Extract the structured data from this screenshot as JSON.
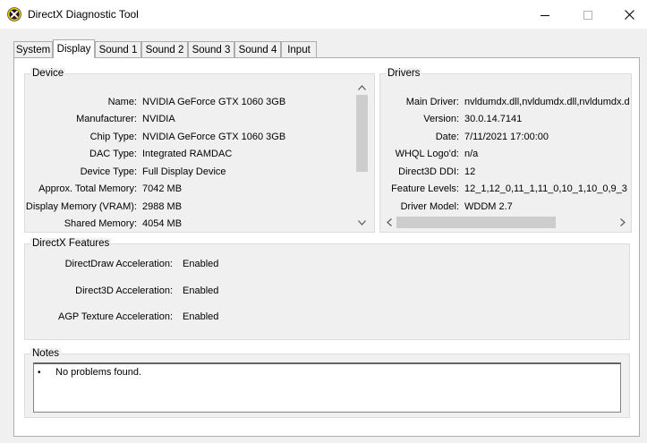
{
  "window": {
    "title": "DirectX Diagnostic Tool",
    "icon": "directx-x-icon"
  },
  "tabs": [
    {
      "label": "System",
      "active": false
    },
    {
      "label": "Display",
      "active": true
    },
    {
      "label": "Sound 1",
      "active": false
    },
    {
      "label": "Sound 2",
      "active": false
    },
    {
      "label": "Sound 3",
      "active": false
    },
    {
      "label": "Sound 4",
      "active": false
    },
    {
      "label": "Input",
      "active": false
    }
  ],
  "device": {
    "title": "Device",
    "rows": [
      {
        "label": "Name:",
        "value": "NVIDIA GeForce GTX 1060 3GB"
      },
      {
        "label": "Manufacturer:",
        "value": "NVIDIA"
      },
      {
        "label": "Chip Type:",
        "value": "NVIDIA GeForce GTX 1060 3GB"
      },
      {
        "label": "DAC Type:",
        "value": "Integrated RAMDAC"
      },
      {
        "label": "Device Type:",
        "value": "Full Display Device"
      },
      {
        "label": "Approx. Total Memory:",
        "value": "7042 MB"
      },
      {
        "label": "Display Memory (VRAM):",
        "value": "2988 MB"
      },
      {
        "label": "Shared Memory:",
        "value": "4054 MB"
      }
    ]
  },
  "drivers": {
    "title": "Drivers",
    "rows": [
      {
        "label": "Main Driver:",
        "value": "nvldumdx.dll,nvldumdx.dll,nvldumdx.d"
      },
      {
        "label": "Version:",
        "value": "30.0.14.7141"
      },
      {
        "label": "Date:",
        "value": "7/11/2021 17:00:00"
      },
      {
        "label": "WHQL Logo'd:",
        "value": "n/a"
      },
      {
        "label": "Direct3D DDI:",
        "value": "12"
      },
      {
        "label": "Feature Levels:",
        "value": "12_1,12_0,11_1,11_0,10_1,10_0,9_3"
      },
      {
        "label": "Driver Model:",
        "value": "WDDM 2.7"
      }
    ]
  },
  "features": {
    "title": "DirectX Features",
    "rows": [
      {
        "label": "DirectDraw Acceleration:",
        "value": "Enabled"
      },
      {
        "label": "Direct3D Acceleration:",
        "value": "Enabled"
      },
      {
        "label": "AGP Texture Acceleration:",
        "value": "Enabled"
      }
    ]
  },
  "notes": {
    "title": "Notes",
    "items": [
      "No problems found."
    ]
  },
  "colors": {
    "titlebar_bg": "#ffffff",
    "window_bg": "#f0f0f0",
    "scroll_thumb": "#cdcdcd"
  }
}
